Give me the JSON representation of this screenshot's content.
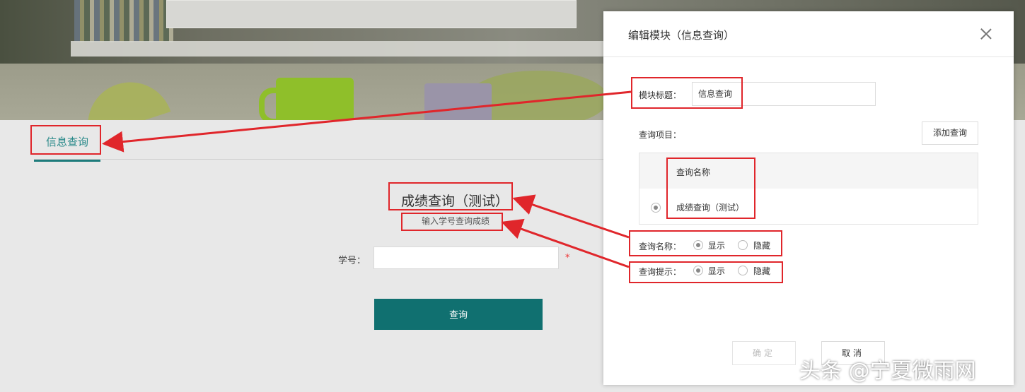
{
  "page": {
    "tab_label": "信息查询",
    "query_title": "成绩查询（测试）",
    "query_hint": "输入学号查询成绩",
    "student_id_label": "学号：",
    "required_mark": "*",
    "query_button": "查询"
  },
  "modal": {
    "title": "编辑模块（信息查询）",
    "module_title_label": "模块标题：",
    "module_title_value": "信息查询",
    "query_items_label": "查询项目：",
    "add_query_button": "添加查询",
    "table_header": "查询名称",
    "table_row_name": "成绩查询（测试）",
    "name_label": "查询名称：",
    "hint_label": "查询提示：",
    "show_option": "显示",
    "hide_option": "隐藏",
    "confirm_button": "确定",
    "cancel_button": "取消"
  },
  "watermark": "头条 @宁夏微雨网",
  "colors": {
    "accent": "#107070",
    "highlight": "#e0262b"
  }
}
